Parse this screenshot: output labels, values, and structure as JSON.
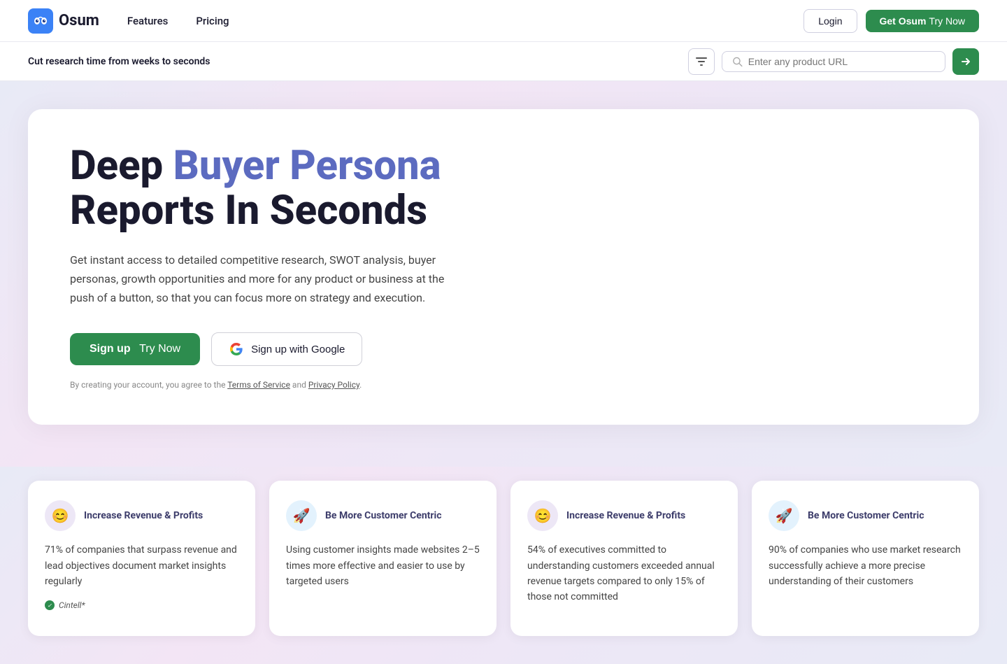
{
  "nav": {
    "logo_text": "Osum",
    "links": [
      {
        "label": "Features",
        "id": "features"
      },
      {
        "label": "Pricing",
        "id": "pricing"
      }
    ],
    "login_label": "Login",
    "get_osum_label": "Get Osum",
    "get_osum_try": "Try Now"
  },
  "toolbar": {
    "tagline": "Cut research time from weeks to seconds",
    "search_placeholder": "Enter any product URL",
    "filter_icon": "≡",
    "go_icon": "›"
  },
  "hero": {
    "title_plain": "Deep ",
    "title_accent": "Buyer Persona",
    "title_rest": "Reports In Seconds",
    "description": "Get instant access to detailed competitive research, SWOT analysis, buyer personas, growth opportunities and more for any product or business at the push of a button, so that you can focus more on strategy and execution.",
    "btn_signup_label": "Sign up",
    "btn_signup_try": "Try Now",
    "btn_google_label": "Sign up with Google",
    "terms_prefix": "By creating your account, you agree to the ",
    "terms_link1": "Terms of Service",
    "terms_and": " and ",
    "terms_link2": "Privacy Policy",
    "terms_suffix": "."
  },
  "cards": [
    {
      "id": "card1",
      "icon": "😊",
      "icon_variant": "purple",
      "title": "Increase Revenue & Profits",
      "body": "71% of companies that surpass revenue and lead objectives document market insights regularly",
      "source": "Cintell*",
      "partial": true
    },
    {
      "id": "card2",
      "icon": "🚀",
      "icon_variant": "blue",
      "title": "Be More Customer Centric",
      "body": "Using customer insights made websites 2–5 times more effective and easier to use by targeted users",
      "source": "",
      "partial": true
    },
    {
      "id": "card3",
      "icon": "😊",
      "icon_variant": "purple",
      "title": "Increase Revenue & Profits",
      "body": "54% of executives committed to understanding customers exceeded annual revenue targets compared to only 15% of those not committed",
      "source": "",
      "partial": true
    },
    {
      "id": "card4",
      "icon": "🚀",
      "icon_variant": "blue",
      "title": "Be More Customer Centric",
      "body": "90% of companies who use market research successfully achieve a more precise understanding of their customers",
      "source": "",
      "partial": true
    }
  ]
}
